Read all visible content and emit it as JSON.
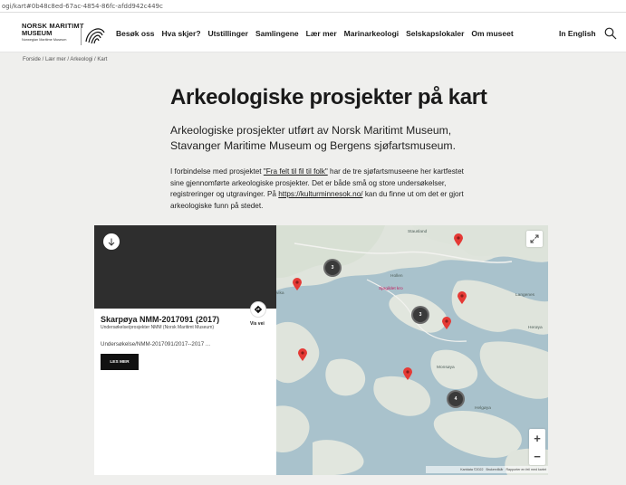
{
  "browser": {
    "url": "ogi/kart#0b48c8ed-67ac-4854-86fc-afdd942c449c"
  },
  "header": {
    "logo": {
      "line1": "NORSK MARITIMT",
      "line2": "MUSEUM",
      "line3": "Norwegian Maritime Museum"
    },
    "nav": [
      "Besøk oss",
      "Hva skjer?",
      "Utstillinger",
      "Samlingene",
      "Lær mer",
      "Marinarkeologi",
      "Selskapslokaler",
      "Om museet"
    ],
    "lang_label": "In English",
    "search_icon": "search-icon"
  },
  "breadcrumb": "Forside / Lær mer / Arkeologi / Kart",
  "main": {
    "title": "Arkeologiske prosjekter på kart",
    "lead": "Arkeologiske prosjekter utført av Norsk Maritimt Museum, Stavanger Maritime Museum og Bergens sjøfartsmuseum.",
    "body_pre": "I forbindelse med prosjektet ",
    "body_link1": "\"Fra felt til fil til folk\"",
    "body_mid": " har de tre sjøfartsmuseene her kartfestet sine gjennomførte arkeologiske prosjekter. Det er både små og store undersøkelser, registreringer og utgravinger. På ",
    "body_link2": "https://kulturminnesok.no/",
    "body_post": " kan du finne ut om det er gjort arkeologiske funn på stedet."
  },
  "panel": {
    "down_icon": "arrow-down-icon",
    "directions_icon": "directions-icon",
    "directions_label": "Vis vei",
    "site_title": "Skarpøya NMM-2017091 (2017)",
    "site_subtitle": "Undersøkelse/prosjekter NMM (Norsk Maritimt Museum)",
    "site_desc": "Undersøkelse/NMM-2017091/2017--2017 ...",
    "read_more": "LES MER"
  },
  "map": {
    "place_names": {
      "stausland": "Stausland",
      "hollen": "Hollen",
      "hollen_poi": "Sjøgildet kro",
      "vika": "vika",
      "langenes": "Langenes",
      "heroya": "Herøya",
      "monsoya": "Monsøya",
      "helgoya": "Helgøya"
    },
    "clusters": [
      "3",
      "3",
      "4"
    ],
    "zoom_in": "+",
    "zoom_out": "−",
    "attribution": [
      "Kartdata ©2022",
      "Brukervilkår",
      "Rapporter en feil med kartet"
    ],
    "colors": {
      "water": "#a9c2cc",
      "land": "#dfe4dc",
      "pin": "#e53935",
      "cluster": "#3a3a3a"
    }
  }
}
